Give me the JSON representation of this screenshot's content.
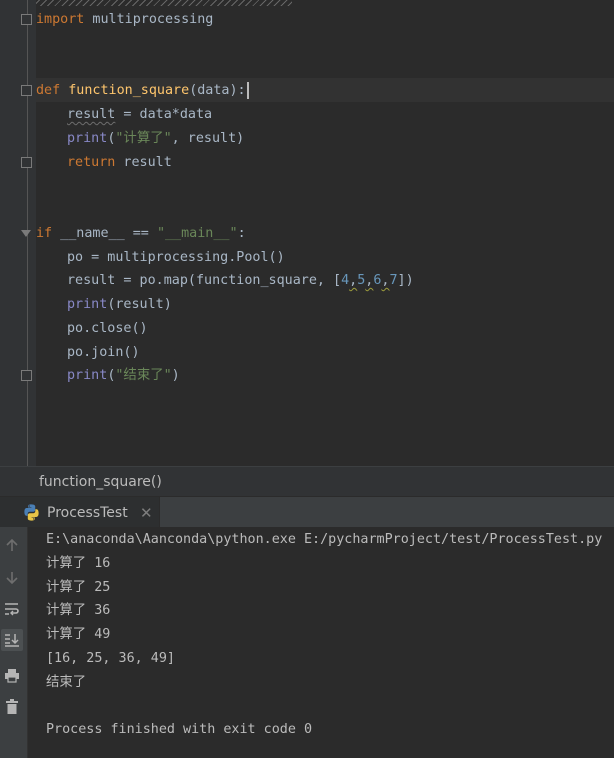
{
  "editor": {
    "lines": {
      "l1_import_kw": "import",
      "l1_module": " multiprocessing",
      "l2_def_kw": "def",
      "l2_fn_name": "function_square",
      "l2_params": "(data):",
      "l3_var": "result",
      "l3_rest": " = data*data",
      "l4_print": "print",
      "l4_open": "(",
      "l4_str": "\"计算了\"",
      "l4_rest": ", result)",
      "l5_return": "return",
      "l5_rest": " result",
      "l6_if": "if",
      "l6_name": " __name__",
      "l6_eq": " == ",
      "l6_str": "\"__main__\"",
      "l6_colon": ":",
      "l7_text": "po = multiprocessing.Pool()",
      "l8_prefix": "result = po.map(function_square, [",
      "l8_n1": "4",
      "l8_c1": ",",
      "l8_n2": "5",
      "l8_c2": ",",
      "l8_n3": "6",
      "l8_c3": ",",
      "l8_n4": "7",
      "l8_suffix": "])",
      "l9_print": "print",
      "l9_rest": "(result)",
      "l10_text": "po.close()",
      "l11_text": "po.join()",
      "l12_print": "print",
      "l12_open": "(",
      "l12_str": "\"结束了\"",
      "l12_close": ")"
    }
  },
  "breadcrumb": {
    "text": "function_square()"
  },
  "run_panel": {
    "tab_label": "ProcessTest",
    "tab_close": "✕",
    "output": [
      "E:\\anaconda\\Aanconda\\python.exe E:/pycharmProject/test/ProcessTest.py",
      "计算了 16",
      "计算了 25",
      "计算了 36",
      "计算了 49",
      "[16, 25, 36, 49]",
      "结束了",
      "",
      "Process finished with exit code 0"
    ],
    "toolbar_icons": [
      "arrow-up-icon",
      "arrow-down-icon",
      "soft-wrap-icon",
      "scroll-to-end-icon",
      "print-icon",
      "trash-icon"
    ]
  },
  "colors": {
    "editor_bg": "#2b2b2b",
    "keyword": "#cc7832",
    "function_name": "#ffc66d",
    "builtin": "#8888c6",
    "string": "#6a8759",
    "number": "#6897bb",
    "text": "#a9b7c6"
  }
}
